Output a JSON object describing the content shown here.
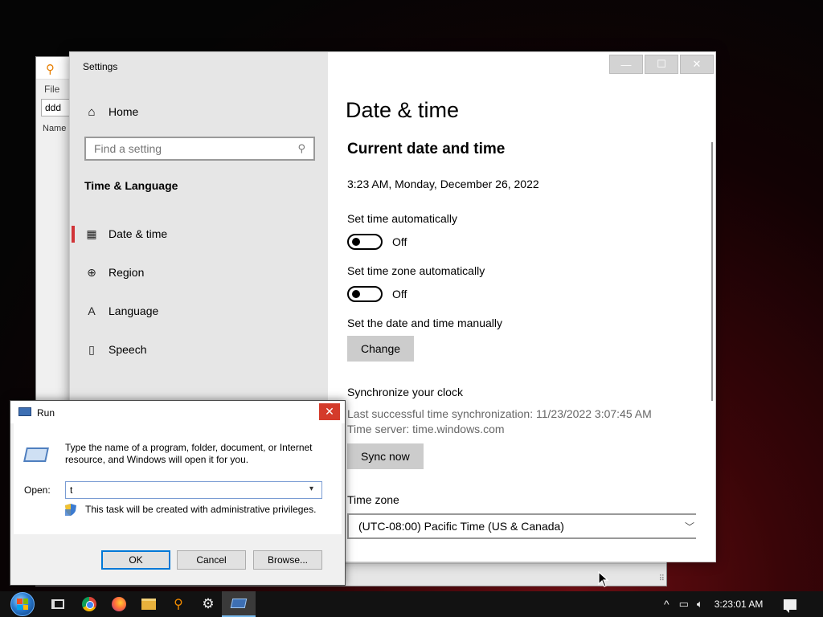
{
  "background_window": {
    "menu_file": "File",
    "input_value": "ddd",
    "column_name": "Name",
    "resize_grip": "⠿"
  },
  "settings": {
    "app_title": "Settings",
    "nav": {
      "home_label": "Home",
      "search_placeholder": "Find a setting",
      "section_title": "Time & Language",
      "items": [
        {
          "label": "Date & time",
          "icon": "calendar-clock-icon",
          "selected": true
        },
        {
          "label": "Region",
          "icon": "globe-icon",
          "selected": false
        },
        {
          "label": "Language",
          "icon": "language-icon",
          "selected": false
        },
        {
          "label": "Speech",
          "icon": "microphone-icon",
          "selected": false
        }
      ]
    },
    "window_controls": {
      "minimize": "—",
      "maximize": "☐",
      "close": "✕"
    },
    "content": {
      "page_title": "Date & time",
      "section_title": "Current date and time",
      "current_datetime": "3:23 AM, Monday, December 26, 2022",
      "set_time_auto_label": "Set time automatically",
      "set_time_auto_state": "Off",
      "set_tz_auto_label": "Set time zone automatically",
      "set_tz_auto_state": "Off",
      "manual_label": "Set the date and time manually",
      "change_button": "Change",
      "sync_title": "Synchronize your clock",
      "last_sync": "Last successful time synchronization: 11/23/2022 3:07:45 AM",
      "time_server": "Time server: time.windows.com",
      "sync_button": "Sync now",
      "timezone_label": "Time zone",
      "timezone_value": "(UTC-08:00) Pacific Time (US & Canada)"
    }
  },
  "run_dialog": {
    "title": "Run",
    "close": "✕",
    "description": "Type the name of a program, folder, document, or Internet resource, and Windows will open it for you.",
    "open_label": "Open:",
    "open_value": "t",
    "admin_note": "This task will be created with administrative privileges.",
    "ok_button": "OK",
    "cancel_button": "Cancel",
    "browse_button": "Browse..."
  },
  "taskbar": {
    "pinned": [
      "start-button",
      "task-view",
      "chrome",
      "firefox",
      "file-explorer",
      "search-app",
      "settings",
      "run"
    ],
    "clock": "3:23:01 AM",
    "tray_chevron": "^",
    "accent_color": "#76b9ed"
  },
  "colors": {
    "selected_nav_marker": "#d13438",
    "run_close": "#d43b2b",
    "primary_button_border": "#0078d7"
  }
}
